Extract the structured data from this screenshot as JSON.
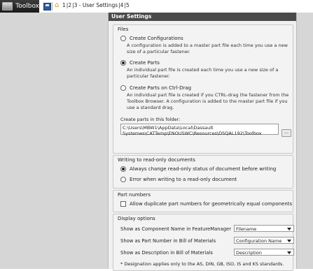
{
  "topbar": {
    "tab_label": "Toolbox",
    "breadcrumbs": [
      "1",
      "2",
      "3 - User Settings",
      "4",
      "5"
    ]
  },
  "panel": {
    "title": "User Settings",
    "files": {
      "title": "Files",
      "options": [
        {
          "label": "Create Configurations",
          "selected": false,
          "desc": "A configuration is added to a master part file each time you use a new size of a particular fastener."
        },
        {
          "label": "Create Parts",
          "selected": true,
          "desc": "An individual part file is created each time you use a new size of a particular fastener."
        },
        {
          "label": "Create Parts on Ctrl-Drag",
          "selected": false,
          "desc": "An individual part file is created if you CTRL-drag the fastener from the Toolbox Browser. A configuration is added to the master part file if you use a standard drag."
        }
      ],
      "folder_label": "Create parts in this folder:",
      "folder_path": "C:\\Users\\MBW1\\AppData\\Local\\Dassault Systemes\\CATTemp\\ENOUSWC\\Resources\\DSQAL192\\Toolbox",
      "browse_label": "..."
    },
    "readonly": {
      "title": "Writing to read-only documents",
      "options": [
        {
          "label": "Always change read-only status of document before writing",
          "selected": true
        },
        {
          "label": "Error when writing to a read-only document",
          "selected": false
        }
      ]
    },
    "partnumbers": {
      "title": "Part numbers",
      "checkbox_label": "Allow duplicate part numbers for geometrically equal components",
      "checked": false
    },
    "display": {
      "title": "Display options",
      "rows": [
        {
          "label": "Show as Component Name in FeatureManager",
          "value": "Filename"
        },
        {
          "label": "Show as Part Number in Bill of Materials",
          "value": "Configuration Name"
        },
        {
          "label": "Show as Description in Bill of Materials",
          "value": "Description"
        }
      ],
      "footnote": "* Designation applies only to the AS, DIN, GB, ISO, IS and KS standards."
    }
  }
}
